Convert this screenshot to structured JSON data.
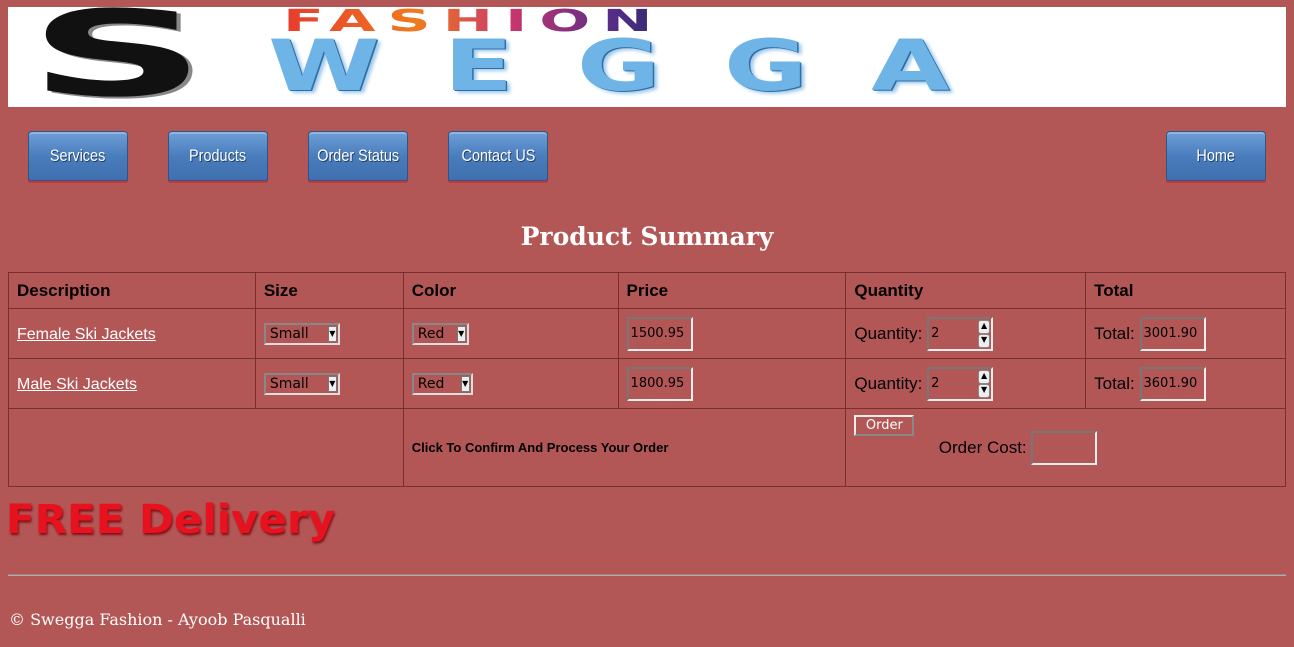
{
  "banner": {
    "logo_letter": "S",
    "brand_top": "FASHION",
    "brand_main": "WEGGA"
  },
  "nav": {
    "services": "Services",
    "products": "Products",
    "order_status": "Order Status",
    "contact": "Contact US",
    "home": "Home"
  },
  "page_title": "Product Summary",
  "table": {
    "headers": [
      "Description",
      "Size",
      "Color",
      "Price",
      "Quantity",
      "Total"
    ],
    "rows": [
      {
        "description": "Female Ski Jackets",
        "size": "Small",
        "color": "Red",
        "price": "1500.95",
        "quantity_label": "Quantity:",
        "quantity": "2",
        "total_label": "Total:",
        "total": "3001.90"
      },
      {
        "description": "Male Ski Jackets",
        "size": "Small",
        "color": "Red",
        "price": "1800.95",
        "quantity_label": "Quantity:",
        "quantity": "2",
        "total_label": "Total:",
        "total": "3601.90"
      }
    ],
    "confirm_text": "Click To Confirm And Process Your Order",
    "order_button": "Order",
    "order_cost_label": "Order Cost:",
    "order_cost": ""
  },
  "promo": "FREE Delivery",
  "footer": "© Swegga Fashion - Ayoob Pasqualli",
  "colors": {
    "background": "#b35656",
    "nav_button": "#4a7dbd",
    "promo_red": "#e8111e"
  }
}
